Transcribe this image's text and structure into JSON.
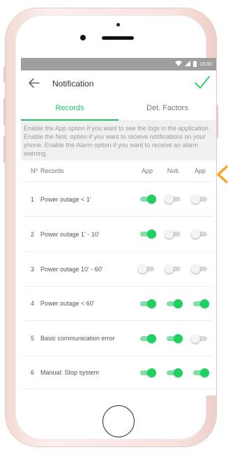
{
  "statusbar": {
    "time": "15:00"
  },
  "header": {
    "title": "Notification"
  },
  "tabs": [
    {
      "label": "Records",
      "active": true
    },
    {
      "label": "Det. Factors",
      "active": false
    }
  ],
  "info_text": "Enable the App option if you want to see the logs in the application. Enable the Noti. option if you want to receive notifications on your phone. Enable the Alarm option if you want to receive an alarm warning.",
  "table": {
    "headers": {
      "no": "Nº",
      "name": "Records",
      "app": "App",
      "noti": "Noti.",
      "alarm": "App"
    },
    "rows": [
      {
        "no": "1",
        "name": "Power outage < 1'",
        "app": true,
        "noti": false,
        "alarm": false
      },
      {
        "no": "2",
        "name": "Power outage 1' - 10'",
        "app": true,
        "noti": false,
        "alarm": false
      },
      {
        "no": "3",
        "name": "Power outage 10' - 60'",
        "app": false,
        "noti": false,
        "alarm": false
      },
      {
        "no": "4",
        "name": "Power outage < 60'",
        "app": true,
        "noti": true,
        "alarm": true
      },
      {
        "no": "5",
        "name": "Basic communication error",
        "app": true,
        "noti": true,
        "alarm": false
      },
      {
        "no": "6",
        "name": "Manual: Stop system",
        "app": true,
        "noti": true,
        "alarm": true
      }
    ]
  },
  "colors": {
    "accent": "#23c36a",
    "switch_on": "#1fd060",
    "arrow": "#f5a623",
    "statusbar": "#9e9e9e"
  },
  "icons": {
    "back": "arrow-left-icon",
    "confirm": "check-icon",
    "hint": "chevron-left-icon"
  }
}
